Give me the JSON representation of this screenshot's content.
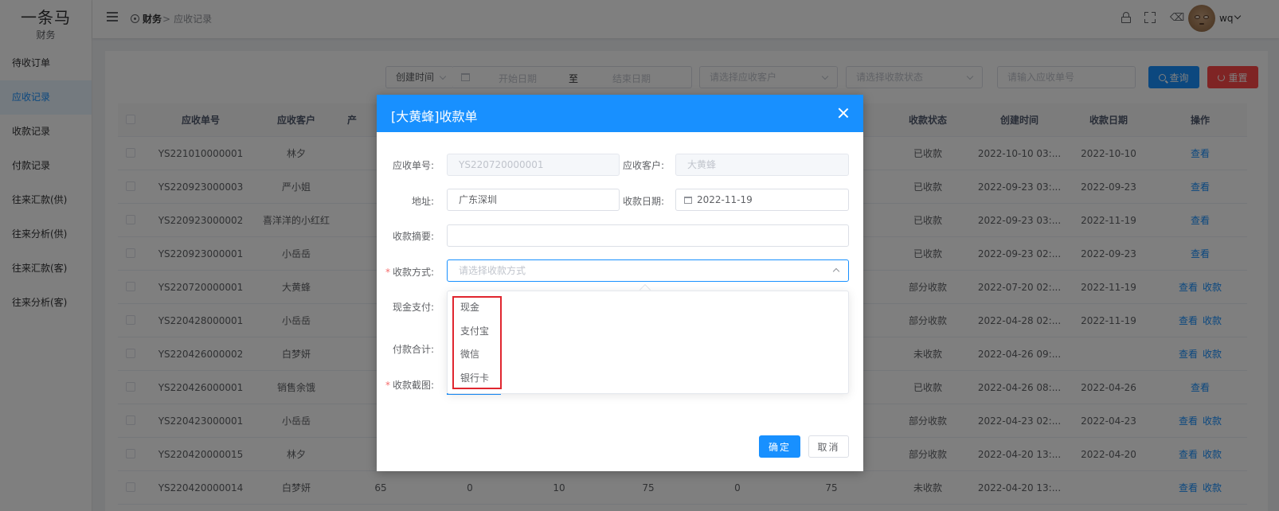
{
  "app": {
    "name": "一条马",
    "subtitle": "财务"
  },
  "sidebar": {
    "items": [
      {
        "label": "待收订单"
      },
      {
        "label": "应收记录"
      },
      {
        "label": "收款记录"
      },
      {
        "label": "付款记录"
      },
      {
        "label": "往来汇款(供)"
      },
      {
        "label": "往来分析(供)"
      },
      {
        "label": "往来汇款(客)"
      },
      {
        "label": "往来分析(客)"
      }
    ],
    "active_index": 1
  },
  "header": {
    "breadcrumb_root": "财务",
    "breadcrumb_sep": ">",
    "breadcrumb_current": "应收记录",
    "username": "wq"
  },
  "filters": {
    "date_type": "创建时间",
    "start_placeholder": "开始日期",
    "to_label": "至",
    "end_placeholder": "结束日期",
    "customer_placeholder": "请选择应收客户",
    "status_placeholder": "请选择收款状态",
    "number_placeholder": "请输入应收单号",
    "query_label": "查询",
    "reset_label": "重置"
  },
  "table": {
    "columns": [
      "应收单号",
      "应收客户",
      "产",
      "收款状态",
      "创建时间",
      "收款日期",
      "操作"
    ],
    "view_label": "查看",
    "collect_label": "收款",
    "rows": [
      {
        "no": "YS221010000001",
        "customer": "林夕",
        "status": "已收款",
        "created": "2022-10-10 03:...",
        "date": "2022-10-10",
        "collect": false
      },
      {
        "no": "YS220923000003",
        "customer": "严小姐",
        "status": "已收款",
        "created": "2022-09-23 03:...",
        "date": "2022-09-23",
        "collect": false
      },
      {
        "no": "YS220923000002",
        "customer": "喜洋洋的小红红",
        "status": "已收款",
        "created": "2022-09-23 03:...",
        "date": "2022-11-19",
        "collect": false
      },
      {
        "no": "YS220923000001",
        "customer": "小岳岳",
        "status": "已收款",
        "created": "2022-09-23 02:...",
        "date": "2022-09-23",
        "collect": false
      },
      {
        "no": "YS220720000001",
        "customer": "大黄蜂",
        "status": "部分收款",
        "created": "2022-07-20 02:...",
        "date": "2022-11-19",
        "collect": true
      },
      {
        "no": "YS220428000001",
        "customer": "小岳岳",
        "status": "部分收款",
        "created": "2022-04-28 02:...",
        "date": "2022-11-19",
        "collect": true
      },
      {
        "no": "YS220426000002",
        "customer": "白梦妍",
        "status": "未收款",
        "created": "2022-04-26 09:...",
        "date": "",
        "collect": true
      },
      {
        "no": "YS220426000001",
        "customer": "销售余饿",
        "status": "已收款",
        "created": "2022-04-26 08:...",
        "date": "2022-04-26",
        "collect": false
      },
      {
        "no": "YS220423000001",
        "customer": "小岳岳",
        "status": "部分收款",
        "created": "2022-04-23 02:...",
        "date": "2022-04-23",
        "collect": true
      },
      {
        "no": "YS220420000015",
        "customer": "林夕",
        "status": "部分收款",
        "created": "2022-04-20 13:...",
        "date": "2022-04-20",
        "collect": true
      },
      {
        "no": "YS220420000014",
        "customer": "白梦妍",
        "status": "未收款",
        "created": "2022-04-20 13:...",
        "date": "",
        "collect": true,
        "extra": [
          "65",
          "0",
          "10",
          "75",
          "0",
          "75"
        ]
      }
    ]
  },
  "dialog": {
    "title": "[大黄蜂]收款单",
    "fields": {
      "order_no_label": "应收单号:",
      "order_no_value": "YS220720000001",
      "customer_label": "应收客户:",
      "customer_value": "大黄蜂",
      "address_label": "地址:",
      "address_value": "广东深圳",
      "date_label": "收款日期:",
      "date_value": "2022-11-19",
      "summary_label": "收款摘要:",
      "method_label": "收款方式:",
      "method_placeholder": "请选择收款方式",
      "cash_label": "现金支付:",
      "total_label": "付款合计:",
      "screenshot_label": "收款截图:",
      "required_mark": "*"
    },
    "method_options": [
      "现金",
      "支付宝",
      "微信",
      "银行卡"
    ],
    "ok_label": "确定",
    "cancel_label": "取消"
  }
}
